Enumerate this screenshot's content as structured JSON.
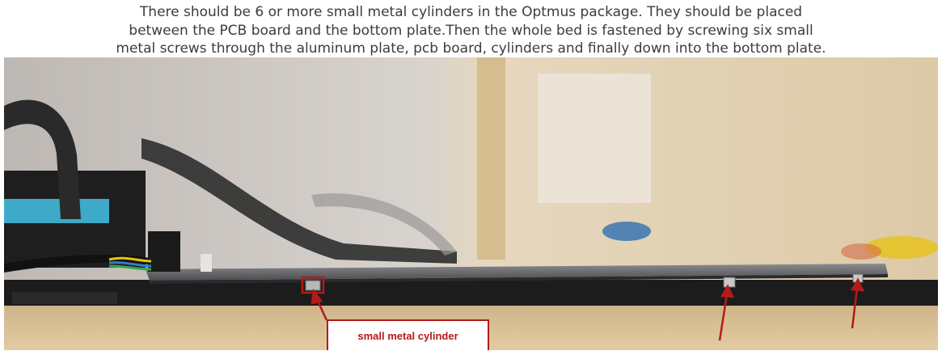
{
  "caption": {
    "line1": "There should be 6 or more small metal cylinders in the Optmus package. They should be placed",
    "line2": "between the PCB board and the bottom plate.Then the whole bed is fastened by screwing six small",
    "line3": "metal screws through the aluminum plate, pcb board, cylinders and finally down into the bottom plate."
  },
  "annotation": {
    "label": "small metal cylinder",
    "color": "#b31b1b"
  },
  "colors": {
    "text": "#3c3c3c",
    "wall": "#d2ccc6",
    "shelf": "#d4b98c",
    "plate": "#1c1c1c"
  }
}
